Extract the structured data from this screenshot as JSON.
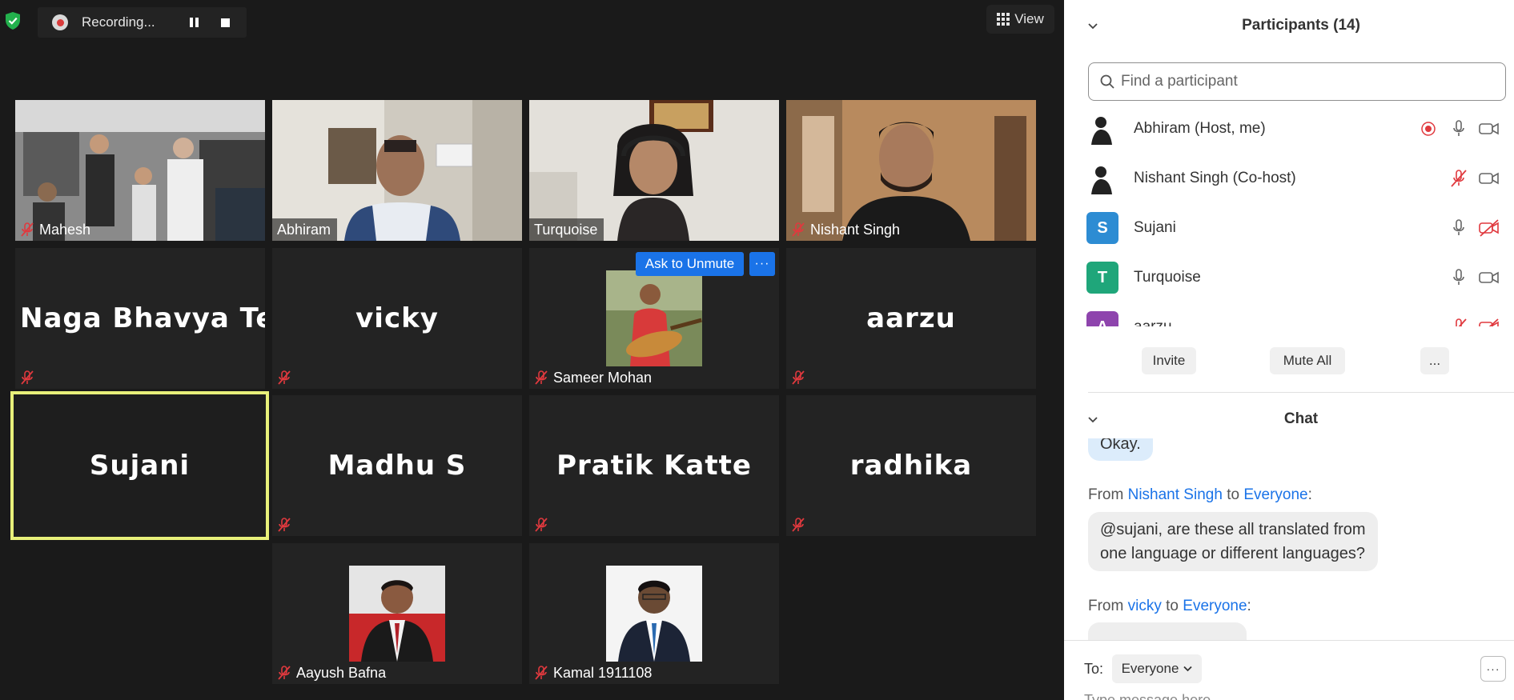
{
  "toolbar": {
    "recording_label": "Recording...",
    "view_label": "View"
  },
  "tiles": {
    "mahesh": "Mahesh",
    "abhiram": "Abhiram",
    "turquoise": "Turquoise",
    "nishant": "Nishant Singh",
    "naga_big": "Naga Bhavya Te...",
    "vicky_big": "vicky",
    "sameer": "Sameer Mohan",
    "aarzu_big": "aarzu",
    "sujani_big": "Sujani",
    "madhu_big": "Madhu S",
    "pratik_big": "Pratik Katte",
    "radhika_big": "radhika",
    "aayush": "Aayush Bafna",
    "kamal": "Kamal 1911108"
  },
  "overlay": {
    "ask_to_unmute": "Ask to Unmute",
    "more": "···"
  },
  "participants": {
    "title": "Participants (14)",
    "search_placeholder": "Find a participant",
    "list": [
      {
        "name": "Abhiram (Host, me)",
        "initial": ""
      },
      {
        "name": "Nishant Singh (Co-host)",
        "initial": ""
      },
      {
        "name": "Sujani",
        "initial": "S",
        "color": "#2d8cd3"
      },
      {
        "name": "Turquoise",
        "initial": "T",
        "color": "#1fa67a"
      },
      {
        "name": "aarzu",
        "initial": "A",
        "color": "#8e44ad"
      }
    ],
    "invite": "Invite",
    "mute_all": "Mute All",
    "more": "..."
  },
  "chat": {
    "title": "Chat",
    "partial_bubble": "Okay.",
    "msg1": {
      "from_prefix": "From",
      "sender": "Nishant Singh",
      "to_word": "to",
      "recipient": "Everyone",
      "colon": ":",
      "line1": "@sujani, are these all translated from",
      "line2": "one language or different languages?"
    },
    "msg2": {
      "from_prefix": "From",
      "sender": "vicky",
      "to_word": "to",
      "recipient": "Everyone",
      "colon": ":"
    },
    "to_label": "To:",
    "to_value": "Everyone",
    "more": "···",
    "type_hint": "Type message here..."
  }
}
